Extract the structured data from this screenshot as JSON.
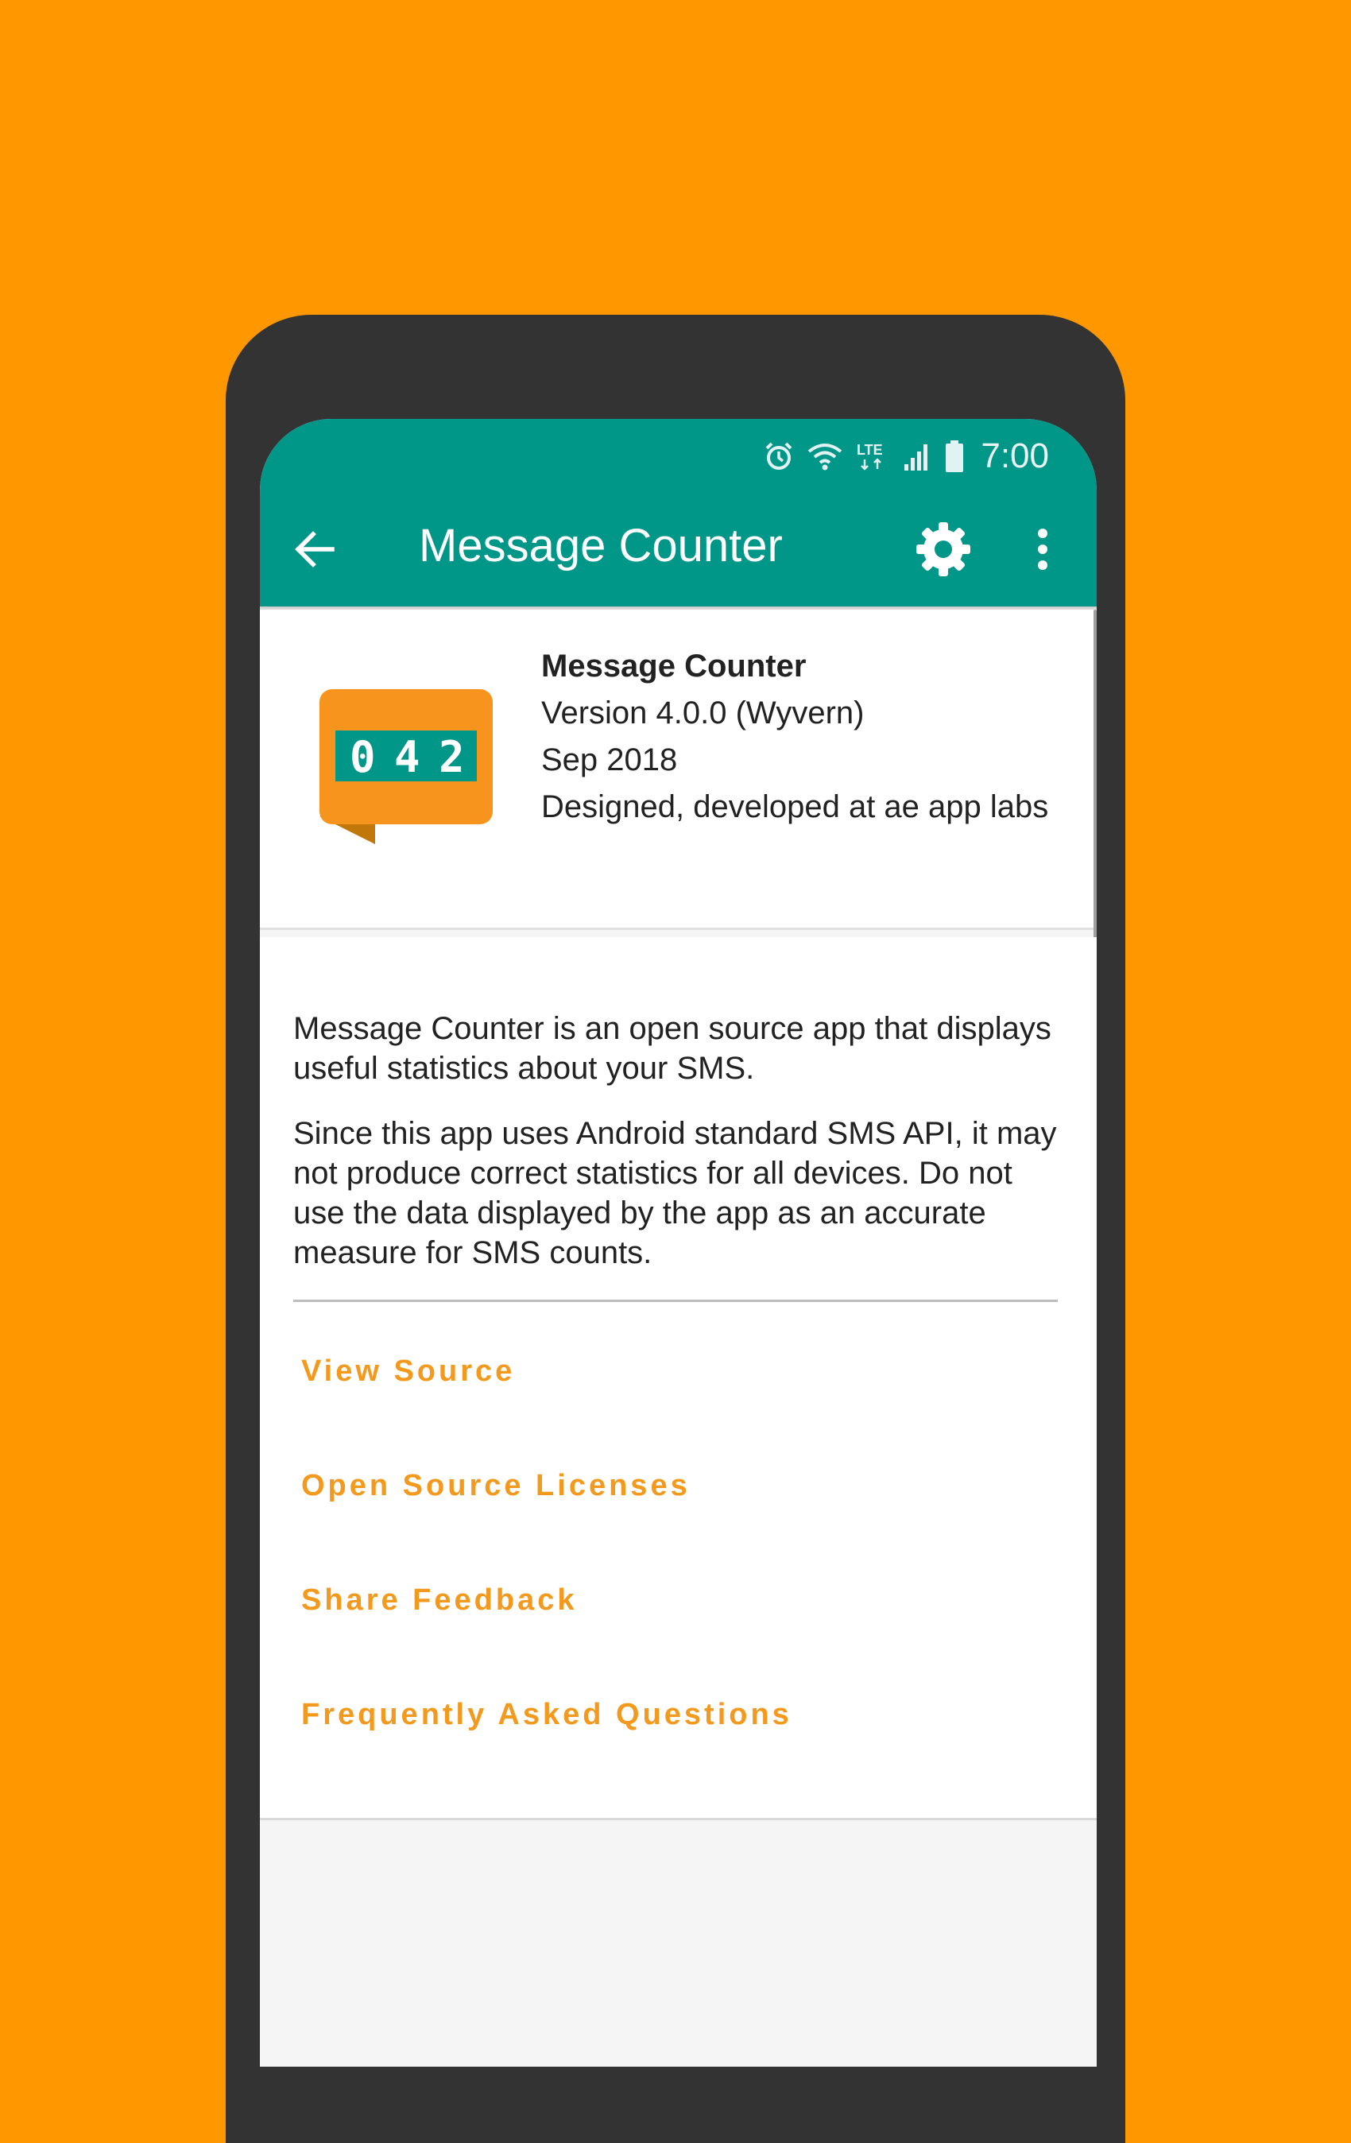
{
  "status_bar": {
    "time": "7:00",
    "network_label": "LTE",
    "icons": [
      "alarm-icon",
      "wifi-icon",
      "lte-icon",
      "signal-icon",
      "battery-icon"
    ]
  },
  "toolbar": {
    "title": "Message Counter",
    "back_icon": "arrow-back-icon",
    "settings_icon": "gear-icon",
    "overflow_icon": "more-vert-icon"
  },
  "app_info": {
    "name": "Message Counter",
    "version": "Version 4.0.0 (Wyvern)",
    "date": "Sep 2018",
    "credits": "Designed, developed at ae app labs",
    "logo_digits": [
      "0",
      "4",
      "2"
    ]
  },
  "description": {
    "paragraph_1": "Message Counter is an open source app that displays useful statistics about your SMS.",
    "paragraph_2": "Since this app uses Android standard SMS API, it may not produce correct statistics for all devices. Do not use the data displayed by the app as an accurate measure for SMS counts."
  },
  "links": {
    "view_source": "View Source",
    "licenses": "Open Source Licenses",
    "feedback": "Share Feedback",
    "faq": "Frequently Asked Questions"
  },
  "colors": {
    "background": "#FF9800",
    "app_bar": "#009688",
    "link": "#F39A1E",
    "device_frame": "#333333"
  }
}
